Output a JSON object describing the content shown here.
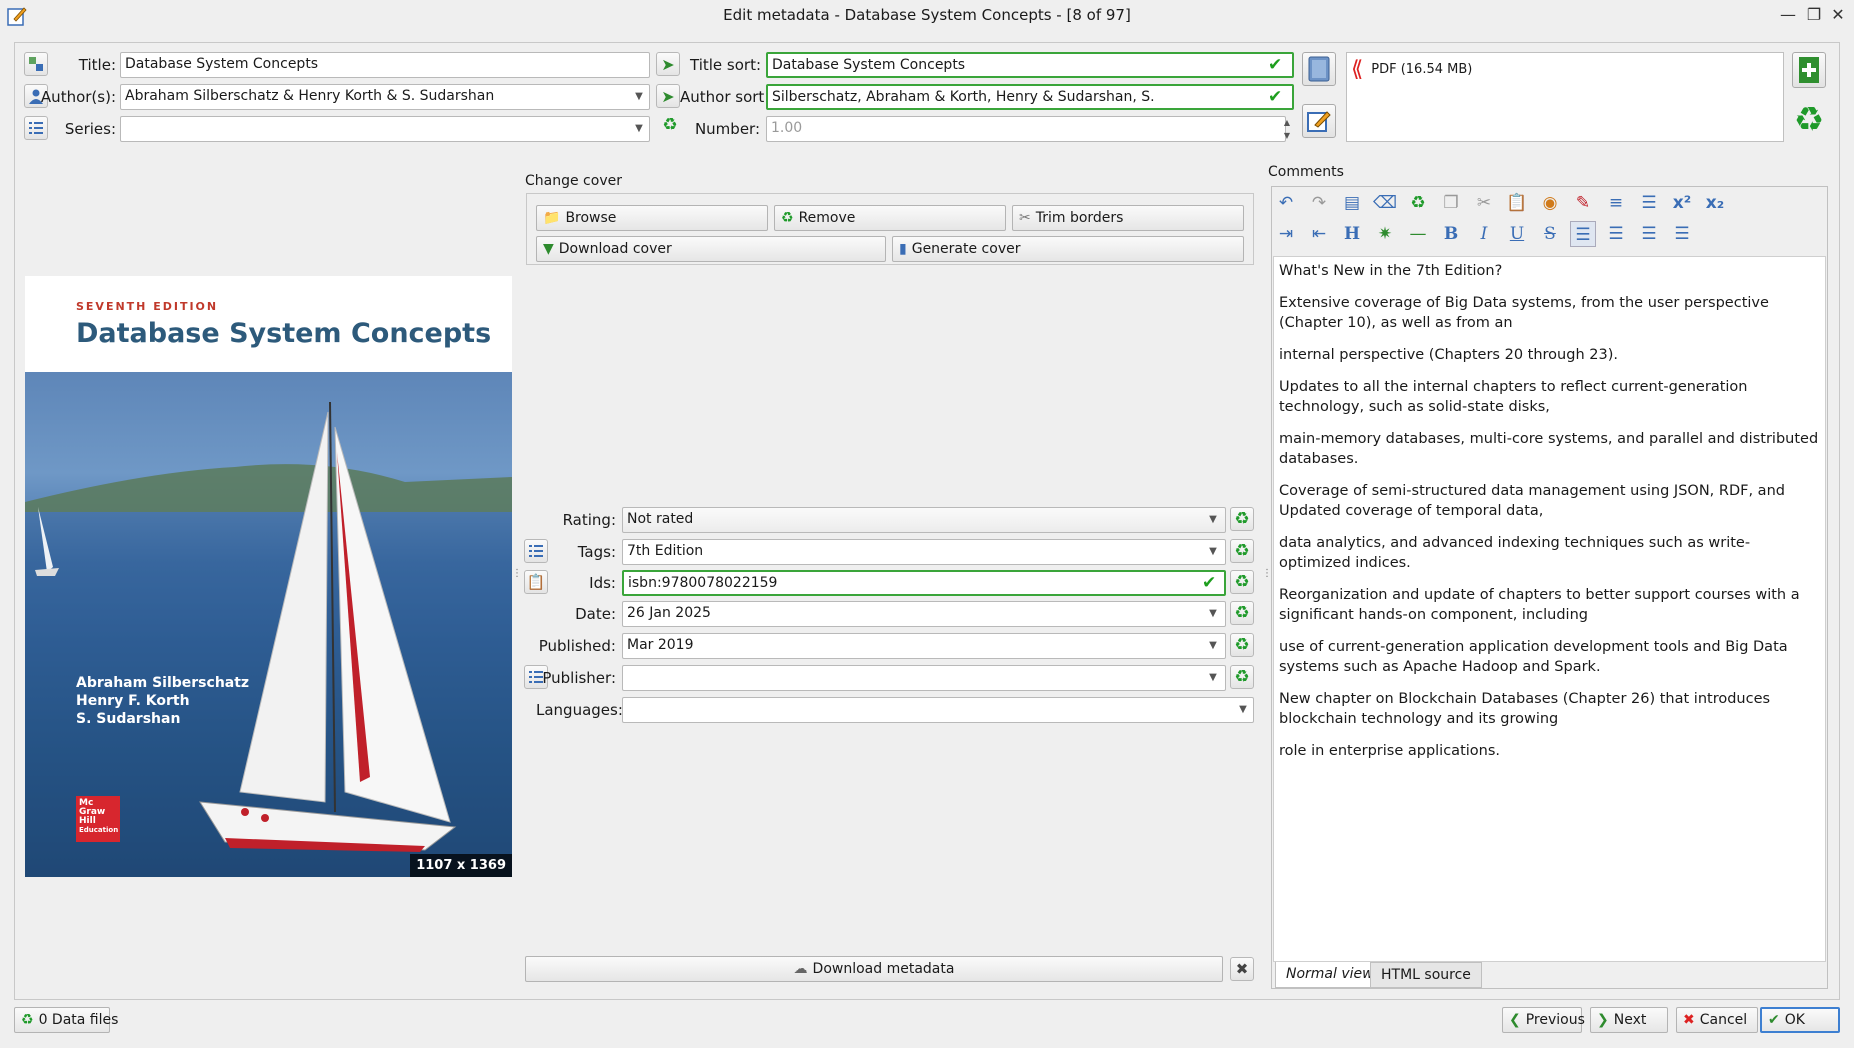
{
  "window": {
    "title": "Edit metadata - Database System Concepts - [8 of 97]"
  },
  "basic": {
    "title_label": "Title:",
    "title_value": "Database System Concepts",
    "title_sort_label": "Title sort:",
    "title_sort_value": "Database System Concepts",
    "authors_label": "Author(s):",
    "authors_value": "Abraham Silberschatz & Henry Korth & S. Sudarshan",
    "author_sort_label": "Author sort:",
    "author_sort_value": "Silberschatz, Abraham & Korth, Henry & Sudarshan, S.",
    "series_label": "Series:",
    "series_value": "",
    "number_label": "Number:",
    "number_value": "1.00"
  },
  "formats": {
    "items": [
      {
        "label": "PDF (16.54 MB)"
      }
    ]
  },
  "cover": {
    "section_label": "Change cover",
    "browse": "Browse",
    "remove": "Remove",
    "trim": "Trim borders",
    "download": "Download cover",
    "generate": "Generate cover",
    "edition": "SEVENTH EDITION",
    "book_title": "Database System Concepts",
    "authors": [
      "Abraham Silberschatz",
      "Henry F. Korth",
      "S. Sudarshan"
    ],
    "publisher_logo": [
      "Mc",
      "Graw",
      "Hill",
      "Education"
    ],
    "dimensions": "1107 x 1369"
  },
  "details": {
    "rating_label": "Rating:",
    "rating_value": "Not rated",
    "tags_label": "Tags:",
    "tags_value": "7th Edition",
    "ids_label": "Ids:",
    "ids_value": "isbn:9780078022159",
    "date_label": "Date:",
    "date_value": "26 Jan 2025",
    "published_label": "Published:",
    "published_value": "Mar 2019",
    "publisher_label": "Publisher:",
    "publisher_value": "",
    "languages_label": "Languages:",
    "languages_value": ""
  },
  "download_metadata": "Download metadata",
  "comments": {
    "label": "Comments",
    "paragraphs": [
      "What's New in the 7th Edition?",
      "Extensive coverage of Big Data systems, from the user perspective (Chapter 10), as well as from an",
      "internal perspective (Chapters 20 through 23).",
      "Updates to all the internal chapters to reflect current-generation technology, such as solid-state disks,",
      "main-memory databases, multi-core systems, and parallel and distributed databases.",
      "Coverage of semi-structured data management using JSON, RDF, and Updated coverage of temporal data,",
      "data analytics, and advanced indexing techniques such as write-optimized indices.",
      "Reorganization and update of chapters to better support courses with a significant hands-on component, including",
      "use of current-generation application development tools and Big Data systems such as Apache Hadoop and Spark.",
      "New chapter on Blockchain Databases (Chapter 26) that introduces blockchain technology and its growing",
      "role in enterprise applications."
    ],
    "tab_normal": "Normal view",
    "tab_html": "HTML source"
  },
  "footer": {
    "data_files": "0 Data files",
    "previous": "Previous",
    "next": "Next",
    "cancel": "Cancel",
    "ok": "OK"
  },
  "colors": {
    "valid_border": "#3aa53a",
    "recycle_green": "#1f9a2a",
    "ok_border": "#3d7fd1"
  }
}
